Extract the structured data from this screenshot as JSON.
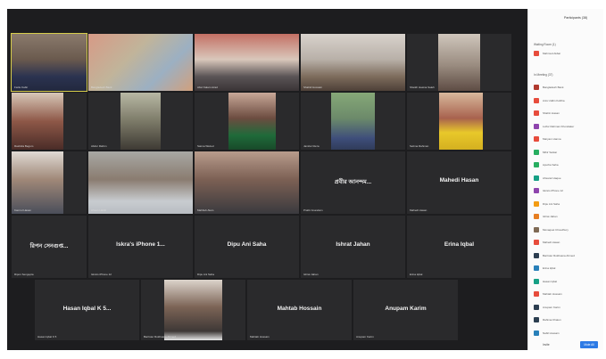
{
  "participants_panel": {
    "title": "Participants (38)",
    "waiting_room": "Waiting Room (1)",
    "waiting_person": "Mahmud Akbar",
    "in_meeting": "In Meeting (37)",
    "people": [
      {
        "name": "Bangladesh Bank",
        "avatar_color": "#b03a2e"
      },
      {
        "name": "Anis Uddin Kolitha",
        "avatar_color": "#e74c3c"
      },
      {
        "name": "Shahin Hasan",
        "avatar_color": "#e74c3c"
      },
      {
        "name": "Lutfor Rahman Khondaker",
        "avatar_color": "#8e44ad"
      },
      {
        "name": "Maryam Hanna",
        "avatar_color": "#e74c3c"
      },
      {
        "name": "Mihir Sarkar",
        "avatar_color": "#27ae60"
      },
      {
        "name": "Apurba Saha",
        "avatar_color": "#27ae60"
      },
      {
        "name": "Ahsanul Haque",
        "avatar_color": "#16a085"
      },
      {
        "name": "Iskra's iPhone 12",
        "avatar_color": "#8e44ad"
      },
      {
        "name": "Dipu Ani Saha",
        "avatar_color": "#f39c12"
      },
      {
        "name": "Ishrat Jahan",
        "avatar_color": "#e67e22"
      },
      {
        "name": "Monaquet Choudhury",
        "avatar_color": "#7f6a55"
      },
      {
        "name": "Mahedi Hasan",
        "avatar_color": "#e74c3c"
      },
      {
        "name": "Barrister Rokhsana Ahmed",
        "avatar_color": "#2c3e50"
      },
      {
        "name": "Erina Iqbal",
        "avatar_color": "#2980b9"
      },
      {
        "name": "Hasan Iqbal",
        "avatar_color": "#16a085"
      },
      {
        "name": "Mahtab Hossain",
        "avatar_color": "#e74c3c"
      },
      {
        "name": "Anupam Karim",
        "avatar_color": "#2c3e50"
      },
      {
        "name": "Rahima Khatun",
        "avatar_color": "#2c3e50"
      },
      {
        "name": "Nabil Hossain",
        "avatar_color": "#2980b9"
      }
    ],
    "invite_label": "Invite",
    "mute_all_label": "Mute All"
  },
  "tiles": [
    {
      "type": "video",
      "caption": "Fazle Kabir",
      "photo": "#7d6b5c"
    },
    {
      "type": "video",
      "caption": "Bangladesh Bank",
      "photo": "#b8957c"
    },
    {
      "type": "video",
      "caption": "Abul Kalam Azad",
      "photo": "#b76e62"
    },
    {
      "type": "video",
      "caption": "Shahid Hossain",
      "photo": "#c7c0b8"
    },
    {
      "type": "video",
      "caption": "Sheikh Hasina Saleh",
      "photo": "#9b8a7b"
    },
    {
      "type": "video",
      "caption": "Rashida Begum",
      "photo": "#6a4a3e"
    },
    {
      "type": "video",
      "caption": "Abdur Rahim",
      "photo": "#8a8d7a"
    },
    {
      "type": "video",
      "caption": "Saima Wazed",
      "photo": "#6d5448"
    },
    {
      "type": "video",
      "caption": "Jamilur Reza",
      "photo": "#6e8a6a"
    },
    {
      "type": "video",
      "caption": "Selima Rahman",
      "photo": "#c9a445"
    },
    {
      "type": "video",
      "caption": "Kamrul Hasan",
      "photo": "#8c8680"
    },
    {
      "type": "video",
      "caption": "Ahsan Habib",
      "photo": "#8a8c8a"
    },
    {
      "type": "video",
      "caption": "Mahbub Alam",
      "photo": "#7a6c62"
    },
    {
      "type": "name",
      "name": "প্রবীর আনন্দম...",
      "caption": "Prabir Anandam"
    },
    {
      "type": "name",
      "name": "Mahedi Hasan",
      "caption": "Mahedi Hasan"
    },
    {
      "type": "name",
      "name": "রিপন সেনগুপ্ত...",
      "caption": "Ripon Sengupta"
    },
    {
      "type": "name",
      "name": "Iskra's iPhone 1...",
      "caption": "Iskra's iPhone 12"
    },
    {
      "type": "name",
      "name": "Dipu Ani Saha",
      "caption": "Dipu Ani Saha"
    },
    {
      "type": "name",
      "name": "Ishrat Jahan",
      "caption": "Ishrat Jahan"
    },
    {
      "type": "name",
      "name": "Erina Iqbal",
      "caption": "Erina Iqbal"
    },
    {
      "type": "name",
      "name": "Hasan Iqbal K 5...",
      "caption": "Hasan Iqbal K 5"
    },
    {
      "type": "video",
      "caption": "Barrister Rokhsana Ahmed",
      "photo": "#6e5d52"
    },
    {
      "type": "name",
      "name": "Mahtab Hossain",
      "caption": "Mahtab Hossain"
    },
    {
      "type": "name",
      "name": "Anupam Karim",
      "caption": "Anupam Karim"
    }
  ]
}
